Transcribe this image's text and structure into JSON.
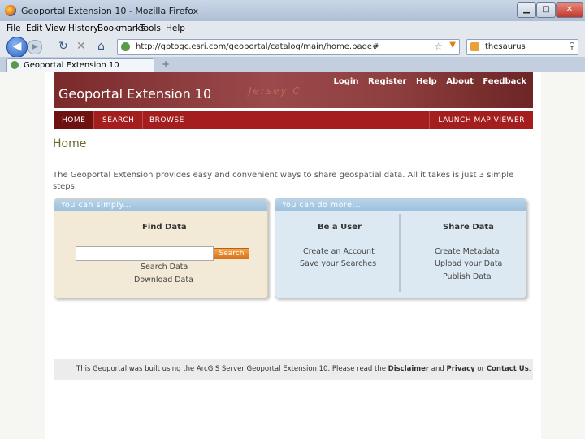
{
  "window": {
    "title": "Geoportal Extension 10 - Mozilla Firefox",
    "minimize": "▁",
    "maximize": "□",
    "close": "✕"
  },
  "menu": [
    "File",
    "Edit",
    "View",
    "History",
    "Bookmarks",
    "Tools",
    "Help"
  ],
  "nav": {
    "url": "http://gptogc.esri.com/geoportal/catalog/main/home.page#",
    "search_value": "thesaurus"
  },
  "tab": {
    "label": "Geoportal Extension 10",
    "new_tab": "+"
  },
  "site": {
    "title": "Geoportal Extension 10",
    "banner_text": "Jersey C",
    "toplinks": [
      "Login",
      "Register",
      "Help",
      "About",
      "Feedback"
    ],
    "mainnav": {
      "home": "HOME",
      "search": "SEARCH",
      "browse": "BROWSE",
      "launch": "LAUNCH MAP VIEWER"
    },
    "heading": "Home",
    "intro": "The Geoportal Extension provides easy and convenient ways to share geospatial data. All it takes is just 3 simple steps."
  },
  "panel_left": {
    "header": "You can simply...",
    "title": "Find Data",
    "search_value": "",
    "search_button": "Search",
    "links": [
      "Search Data",
      "Download Data"
    ]
  },
  "panel_right": {
    "header": "You can do more...",
    "col1": {
      "title": "Be a User",
      "links": [
        "Create an Account",
        "Save your Searches"
      ]
    },
    "col2": {
      "title": "Share Data",
      "links": [
        "Create Metadata",
        "Upload your Data",
        "Publish Data"
      ]
    }
  },
  "footer": {
    "text_before": "This Geoportal was built using the ArcGIS Server Geoportal Extension 10. Please read the",
    "disclaimer": "Disclaimer",
    "and": "and",
    "privacy": "Privacy",
    "or": "or",
    "contact": "Contact Us",
    "end": "."
  }
}
